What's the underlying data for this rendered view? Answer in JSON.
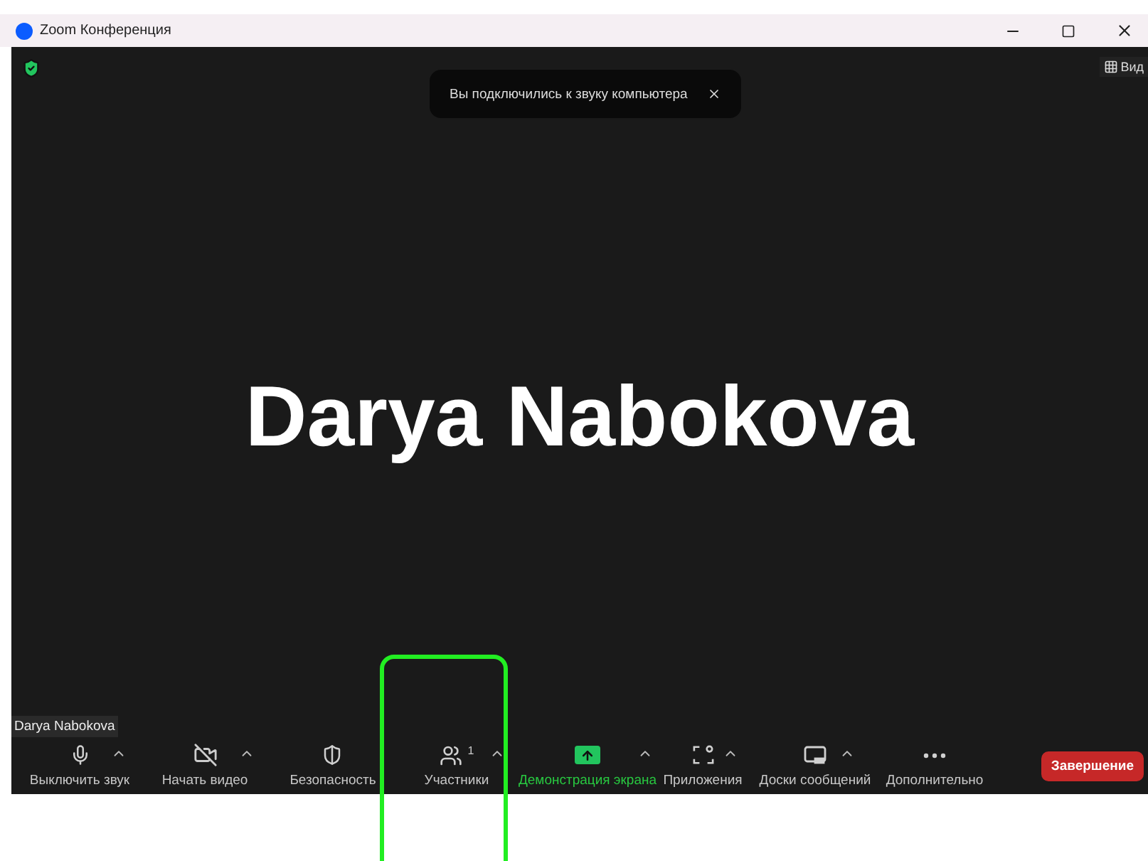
{
  "window": {
    "title": "Zoom Конференция"
  },
  "view_button": {
    "label": "Вид"
  },
  "notification": {
    "text": "Вы подключились к звуку компьютера"
  },
  "participant": {
    "name": "Darya Nabokova",
    "name_tag": "Darya Nabokova"
  },
  "toolbar": {
    "items": [
      {
        "kind": "mic",
        "label": "Выключить звук",
        "menu": true,
        "active": false
      },
      {
        "kind": "video",
        "label": "Начать видео",
        "menu": true,
        "active": false
      },
      {
        "kind": "security",
        "label": "Безопасность",
        "menu": false,
        "active": false
      },
      {
        "kind": "participants",
        "label": "Участники",
        "count": "1",
        "menu": true,
        "active": false
      },
      {
        "kind": "share",
        "label": "Демонстрация экрана",
        "menu": true,
        "active": true
      },
      {
        "kind": "apps",
        "label": "Приложения",
        "menu": true,
        "active": false
      },
      {
        "kind": "whiteboards",
        "label": "Доски сообщений",
        "menu": true,
        "active": false
      },
      {
        "kind": "more",
        "label": "Дополнительно",
        "menu": false,
        "active": false
      }
    ],
    "end_button": {
      "label": "Завершение"
    }
  }
}
